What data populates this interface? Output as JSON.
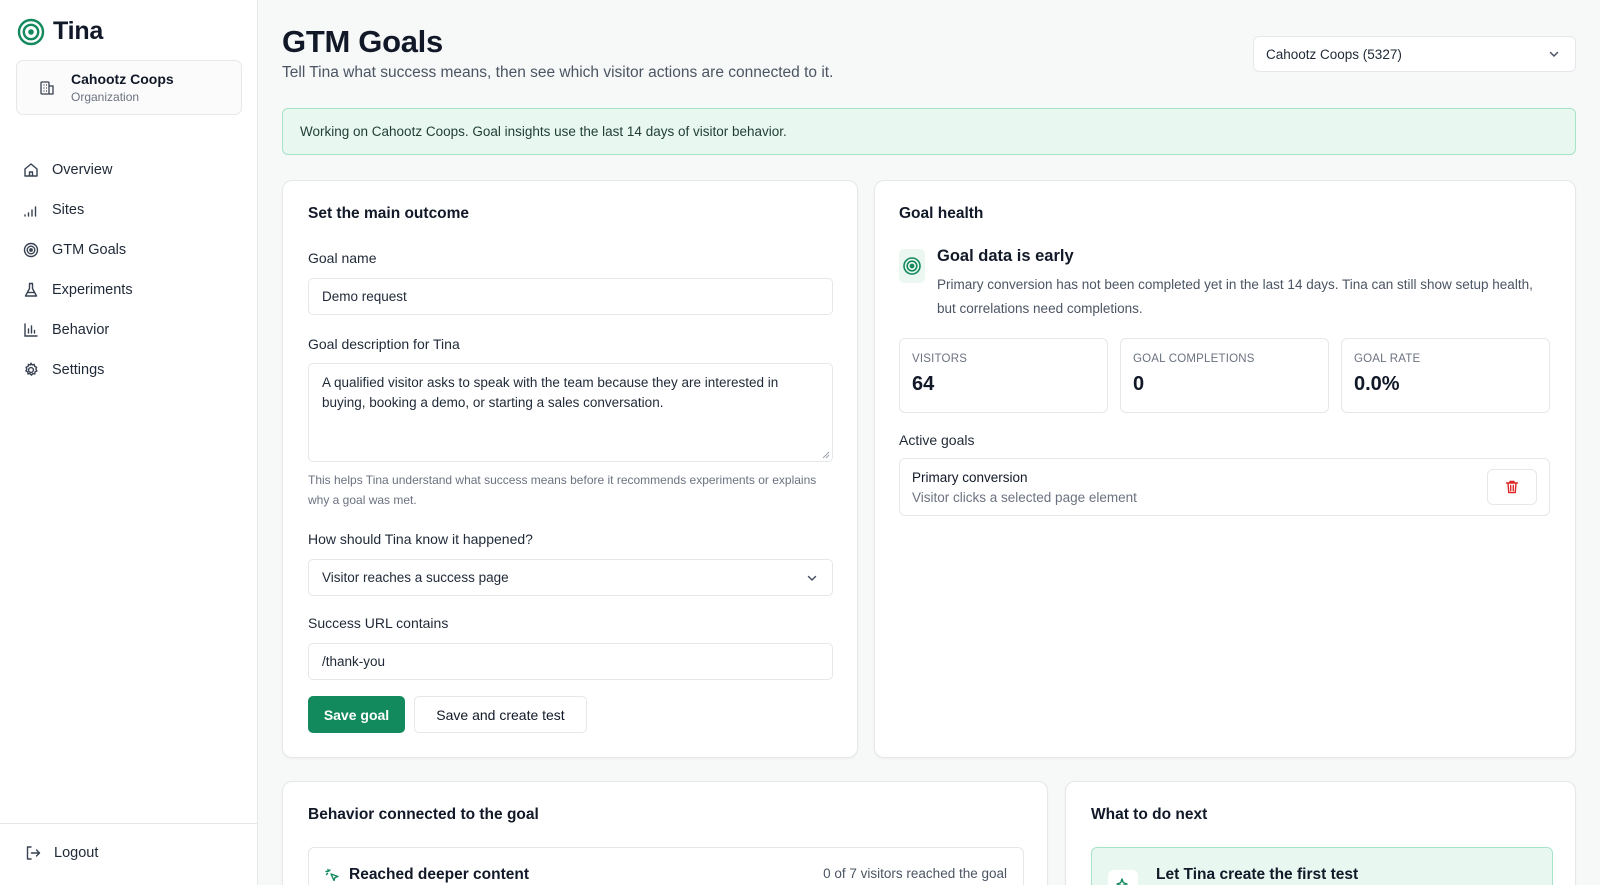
{
  "app": {
    "name": "Tina"
  },
  "org_card": {
    "name": "Cahootz Coops",
    "type": "Organization"
  },
  "nav": {
    "items": [
      {
        "label": "Overview",
        "icon": "home-icon"
      },
      {
        "label": "Sites",
        "icon": "signal-bars-icon"
      },
      {
        "label": "GTM Goals",
        "icon": "target-icon"
      },
      {
        "label": "Experiments",
        "icon": "flask-icon"
      },
      {
        "label": "Behavior",
        "icon": "bar-chart-icon"
      },
      {
        "label": "Settings",
        "icon": "gear-icon"
      }
    ],
    "logout": "Logout"
  },
  "header": {
    "title": "GTM Goals",
    "subtitle": "Tell Tina what success means, then see which visitor actions are connected to it.",
    "org_select": "Cahootz Coops (5327)"
  },
  "banner": {
    "text": "Working on Cahootz Coops. Goal insights use the last 14 days of visitor behavior."
  },
  "outcome_form": {
    "title": "Set the main outcome",
    "goal_name_label": "Goal name",
    "goal_name_value": "Demo request",
    "description_label": "Goal description for Tina",
    "description_value": "A qualified visitor asks to speak with the team because they are interested in buying, booking a demo, or starting a sales conversation.",
    "description_help": "This helps Tina understand what success means before it recommends experiments or explains why a goal was met.",
    "trigger_label": "How should Tina know it happened?",
    "trigger_value": "Visitor reaches a success page",
    "url_label": "Success URL contains",
    "url_value": "/thank-you",
    "save_label": "Save goal",
    "save_test_label": "Save and create test"
  },
  "goal_health": {
    "title": "Goal health",
    "status_title": "Goal data is early",
    "status_text": "Primary conversion has not been completed yet in the last 14 days. Tina can still show setup health, but correlations need completions.",
    "stats": [
      {
        "label": "Visitors",
        "value": "64"
      },
      {
        "label": "Goal completions",
        "value": "0"
      },
      {
        "label": "Goal rate",
        "value": "0.0%"
      }
    ],
    "active_goals_label": "Active goals",
    "active_goals": [
      {
        "name": "Primary conversion",
        "description": "Visitor clicks a selected page element"
      }
    ]
  },
  "behavior": {
    "title": "Behavior connected to the goal",
    "rows": [
      {
        "name": "Reached deeper content",
        "stat": "0 of 7 visitors reached the goal"
      }
    ]
  },
  "next_steps": {
    "title": "What to do next",
    "item_title": "Let Tina create the first test"
  },
  "colors": {
    "accent": "#138a5e",
    "banner_bg": "#e8f8f1",
    "danger": "#dc2626"
  }
}
